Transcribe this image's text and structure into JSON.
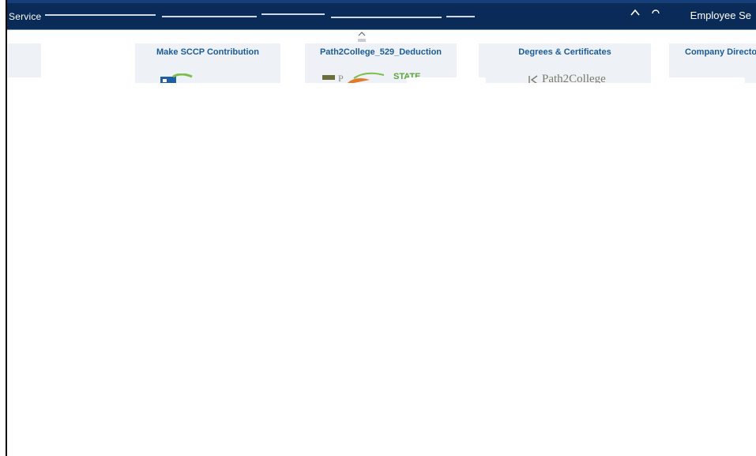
{
  "header": {
    "left_label": "Service",
    "user_label": "Employee Se",
    "controls": {
      "up_icon": "chevron-up",
      "search_icon": "search"
    },
    "colors": {
      "bar": "#0a2a57",
      "accent": "#163e78"
    }
  },
  "collapse": {
    "icon": "chevron-up"
  },
  "tiles": [
    {
      "title": "Make SCCP Contribution"
    },
    {
      "title": "Path2College_529_Deduction",
      "logo_text": "STATE"
    },
    {
      "title": "Degrees & Certificates",
      "logo_text": "Path2College"
    },
    {
      "title": "Company Directo"
    }
  ],
  "colors": {
    "tile_bg": "#eef2f6",
    "tile_title": "#1a5b9c"
  }
}
